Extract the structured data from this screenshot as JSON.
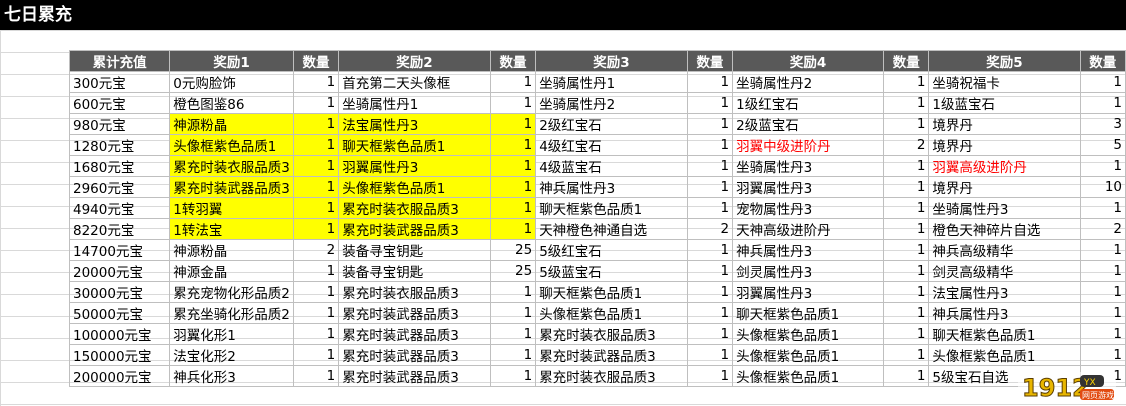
{
  "sheet": {
    "title": "七日累充"
  },
  "table": {
    "headers": [
      "累计充值",
      "奖励1",
      "数量",
      "奖励2",
      "数量",
      "奖励3",
      "数量",
      "奖励4",
      "数量",
      "奖励5",
      "数量"
    ],
    "rows": [
      [
        "300元宝",
        "0元购脸饰",
        "1",
        "首充第二天头像框",
        "1",
        "坐骑属性丹1",
        "1",
        "坐骑属性丹2",
        "1",
        "坐骑祝福卡",
        "1"
      ],
      [
        "600元宝",
        "橙色图鉴86",
        "1",
        "坐骑属性丹1",
        "1",
        "坐骑属性丹2",
        "1",
        "1级红宝石",
        "1",
        "1级蓝宝石",
        "1"
      ],
      [
        "980元宝",
        "神源粉晶",
        "1",
        "法宝属性丹3",
        "1",
        "2级红宝石",
        "1",
        "2级蓝宝石",
        "1",
        "境界丹",
        "3"
      ],
      [
        "1280元宝",
        "头像框紫色品质1",
        "1",
        "聊天框紫色品质1",
        "1",
        "4级红宝石",
        "1",
        "羽翼中级进阶丹",
        "2",
        "境界丹",
        "5"
      ],
      [
        "1680元宝",
        "累充时装衣服品质3",
        "1",
        "羽翼属性丹3",
        "1",
        "4级蓝宝石",
        "1",
        "坐骑属性丹3",
        "1",
        "羽翼高级进阶丹",
        "1"
      ],
      [
        "2960元宝",
        "累充时装武器品质3",
        "1",
        "头像框紫色品质1",
        "1",
        "神兵属性丹3",
        "1",
        "羽翼属性丹3",
        "1",
        "境界丹",
        "10"
      ],
      [
        "4940元宝",
        "1转羽翼",
        "1",
        "累充时装衣服品质3",
        "1",
        "聊天框紫色品质1",
        "1",
        "宠物属性丹3",
        "1",
        "坐骑属性丹3",
        "1"
      ],
      [
        "8220元宝",
        "1转法宝",
        "1",
        "累充时装武器品质3",
        "1",
        "天神橙色神通自选",
        "2",
        "天神高级进阶丹",
        "1",
        "橙色天神碎片自选",
        "2"
      ],
      [
        "14700元宝",
        "神源粉晶",
        "2",
        "装备寻宝钥匙",
        "25",
        "5级红宝石",
        "1",
        "神兵属性丹3",
        "1",
        "神兵高级精华",
        "1"
      ],
      [
        "20000元宝",
        "神源金晶",
        "1",
        "装备寻宝钥匙",
        "25",
        "5级蓝宝石",
        "1",
        "剑灵属性丹3",
        "1",
        "剑灵高级精华",
        "1"
      ],
      [
        "30000元宝",
        "累充宠物化形品质2",
        "1",
        "累充时装衣服品质3",
        "1",
        "聊天框紫色品质1",
        "1",
        "羽翼属性丹3",
        "1",
        "法宝属性丹3",
        "1"
      ],
      [
        "50000元宝",
        "累充坐骑化形品质2",
        "1",
        "累充时装武器品质3",
        "1",
        "头像框紫色品质1",
        "1",
        "聊天框紫色品质1",
        "1",
        "神兵属性丹3",
        "1"
      ],
      [
        "100000元宝",
        "羽翼化形1",
        "1",
        "累充时装武器品质3",
        "1",
        "累充时装衣服品质3",
        "1",
        "头像框紫色品质1",
        "1",
        "聊天框紫色品质1",
        "1"
      ],
      [
        "150000元宝",
        "法宝化形2",
        "1",
        "累充时装武器品质3",
        "1",
        "累充时装武器品质3",
        "1",
        "头像框紫色品质1",
        "1",
        "头像框紫色品质1",
        "1"
      ],
      [
        "200000元宝",
        "神兵化形3",
        "1",
        "累充时装武器品质3",
        "1",
        "累充时装衣服品质3",
        "1",
        "头像框紫色品质1",
        "1",
        "5级宝石自选",
        "1"
      ]
    ],
    "highlight_rows": [
      2,
      3,
      4,
      5,
      6,
      7
    ],
    "highlight_cols": [
      1,
      2,
      3,
      4
    ],
    "red_cells": [
      [
        3,
        7
      ],
      [
        4,
        9
      ]
    ],
    "colors": {
      "header_bg": "#595959",
      "highlight": "#ffff00",
      "red_text": "#ff0000",
      "title_bg": "#000000"
    }
  },
  "watermark": {
    "text": "1912",
    "badge": "YX",
    "sub": "网页游戏"
  }
}
